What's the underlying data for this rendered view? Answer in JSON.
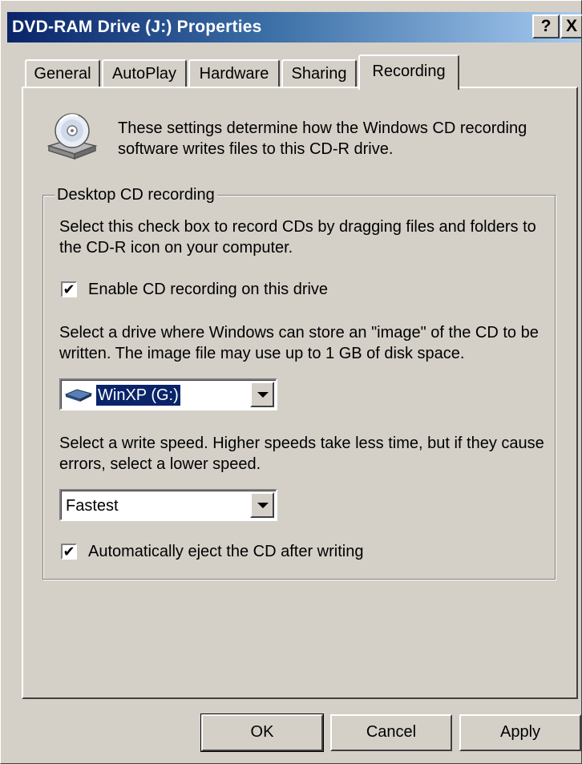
{
  "window": {
    "title": "DVD-RAM Drive (J:) Properties",
    "help_label": "?",
    "close_label": "X"
  },
  "tabs": [
    {
      "label": "General",
      "active": false
    },
    {
      "label": "AutoPlay",
      "active": false
    },
    {
      "label": "Hardware",
      "active": false
    },
    {
      "label": "Sharing",
      "active": false
    },
    {
      "label": "Recording",
      "active": true
    }
  ],
  "intro": {
    "icon": "cd-drive-icon",
    "text": "These settings determine how the Windows CD recording software writes files to this CD-R drive."
  },
  "group": {
    "legend": "Desktop CD recording",
    "description": "Select this check box to record CDs by dragging files and folders to the CD-R icon on your computer.",
    "enable_checkbox": {
      "label": "Enable CD recording on this drive",
      "checked": true
    },
    "image_text": "Select a drive where Windows can store an \"image\" of the CD to be written. The image file may use up to 1 GB of disk space.",
    "image_drive": {
      "value": "WinXP (G:)",
      "icon": "hard-drive-icon"
    },
    "speed_text": "Select a write speed.  Higher speeds take less time, but if they cause errors, select a lower speed.",
    "speed": {
      "value": "Fastest"
    },
    "eject_checkbox": {
      "label": "Automatically eject the CD after writing",
      "checked": true
    }
  },
  "buttons": {
    "ok": "OK",
    "cancel": "Cancel",
    "apply": "Apply"
  },
  "colors": {
    "face": "#d4d0c8",
    "title_start": "#0a246a",
    "title_end": "#a6caf0",
    "selection": "#0a246a"
  }
}
